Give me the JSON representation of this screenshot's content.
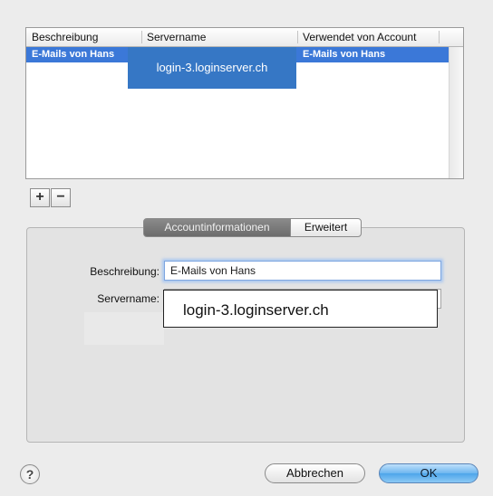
{
  "table": {
    "headers": [
      "Beschreibung",
      "Servername",
      "Verwendet von Account"
    ],
    "rows": [
      {
        "beschreibung": "E-Mails von Hans",
        "servername": "",
        "account": "E-Mails von Hans"
      }
    ],
    "hostname_overlay": "login-3.loginserver.ch"
  },
  "list_buttons": {
    "add": "+",
    "remove": "−"
  },
  "tabs": [
    {
      "label": "Accountinformationen",
      "selected": true
    },
    {
      "label": "Erweitert",
      "selected": false
    }
  ],
  "form": {
    "beschreibung_label": "Beschreibung:",
    "beschreibung_value": "E-Mails von Hans",
    "servername_label": "Servername:",
    "servername_value": "login-3.loginserver.ch"
  },
  "buttons": {
    "help": "?",
    "cancel": "Abbrechen",
    "ok": "OK"
  },
  "colors": {
    "selection": "#3b78d8",
    "overlay": "#3677c5",
    "default_button": "#6db6ef"
  }
}
